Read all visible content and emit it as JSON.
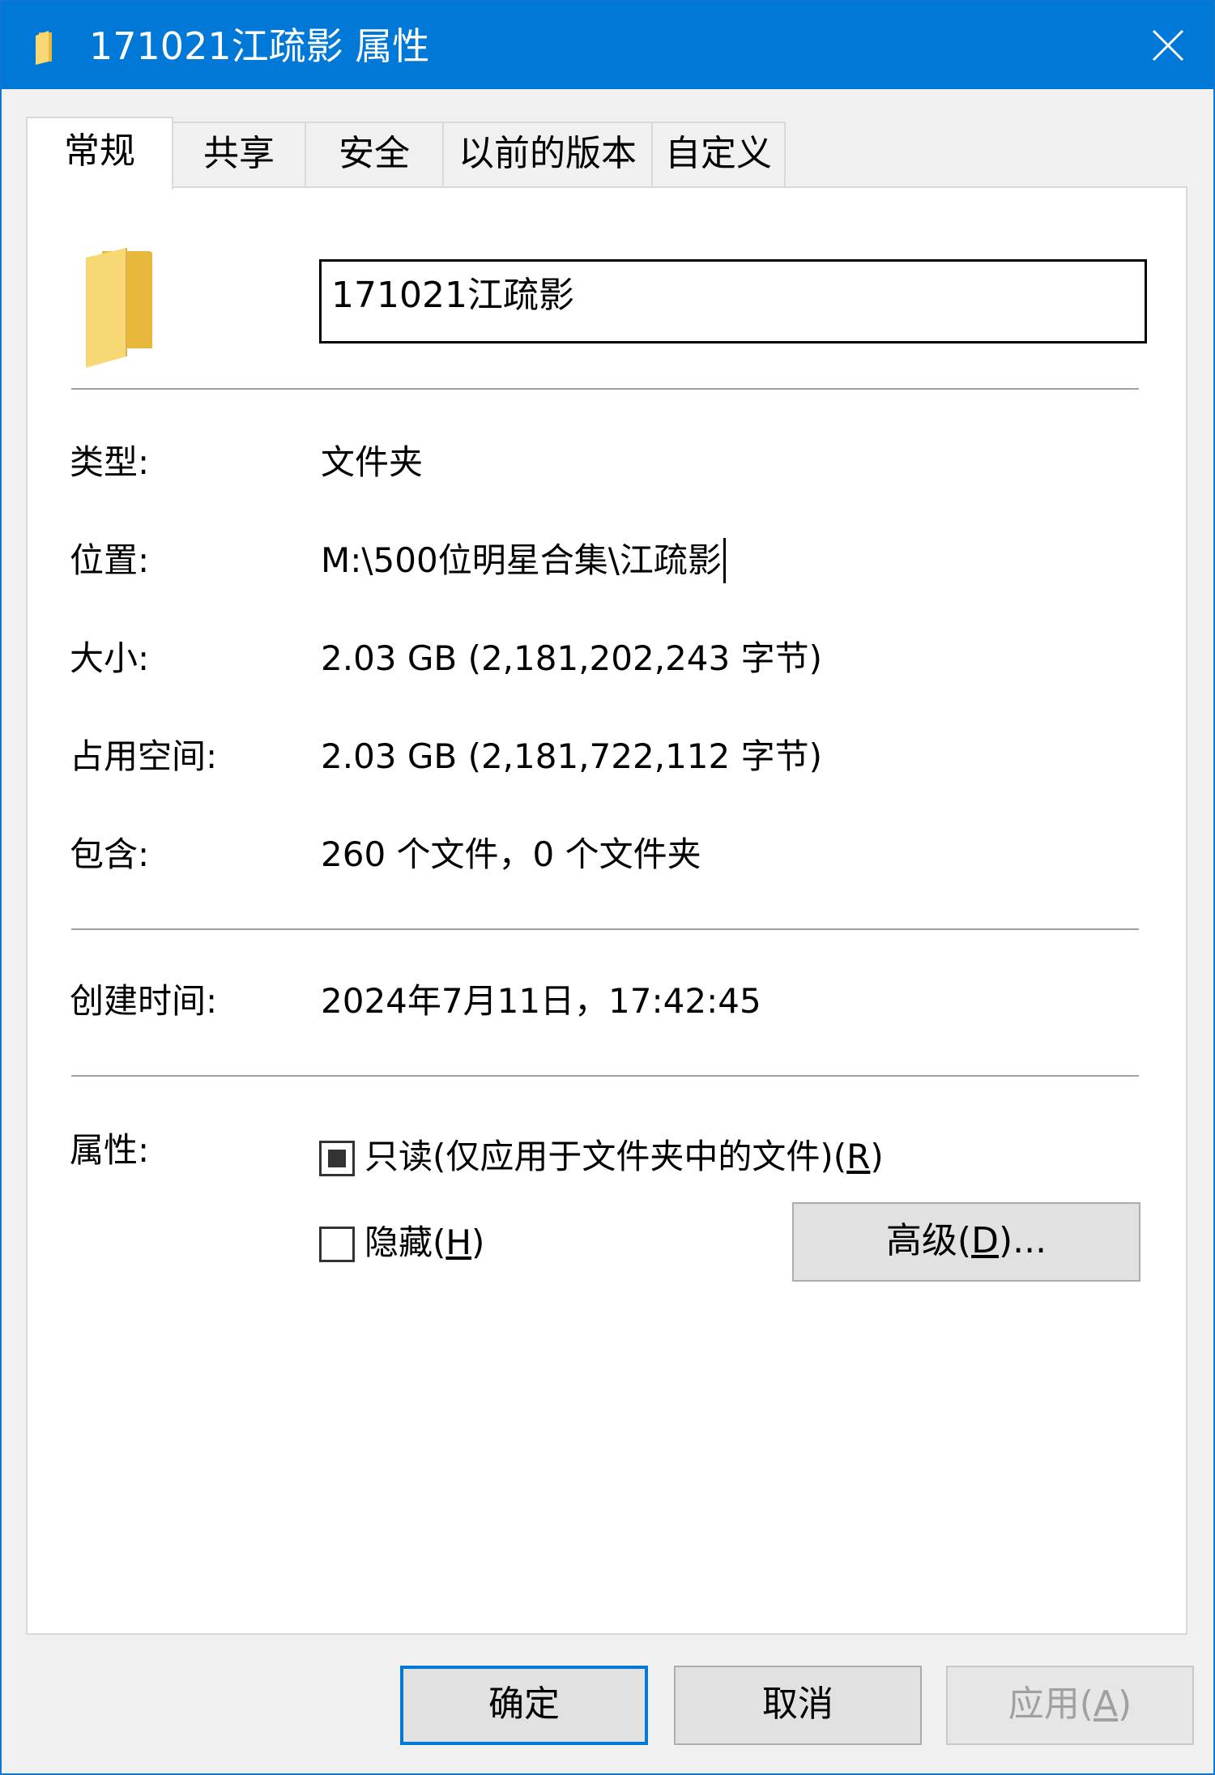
{
  "window": {
    "title": "171021江疏影 属性"
  },
  "tabs": [
    {
      "label": "常规",
      "active": true
    },
    {
      "label": "共享",
      "active": false
    },
    {
      "label": "安全",
      "active": false
    },
    {
      "label": "以前的版本",
      "active": false
    },
    {
      "label": "自定义",
      "active": false
    }
  ],
  "general": {
    "name_value": "171021江疏影",
    "type_label": "类型:",
    "type_value": "文件夹",
    "location_label": "位置:",
    "location_value": "M:\\500位明星合集\\江疏影",
    "size_label": "大小:",
    "size_value": "2.03 GB (2,181,202,243 字节)",
    "size_on_disk_label": "占用空间:",
    "size_on_disk_value": "2.03 GB (2,181,722,112 字节)",
    "contains_label": "包含:",
    "contains_value": "260 个文件，0 个文件夹",
    "created_label": "创建时间:",
    "created_value": "2024年7月11日，17:42:45",
    "attributes_label": "属性:",
    "readonly_label_prefix": "只读(仅应用于文件夹中的文件)(",
    "readonly_accel": "R",
    "readonly_label_suffix": ")",
    "readonly_state": "indeterminate",
    "hidden_label_prefix": "隐藏(",
    "hidden_accel": "H",
    "hidden_label_suffix": ")",
    "hidden_checked": false,
    "advanced_prefix": "高级(",
    "advanced_accel": "D",
    "advanced_suffix": ")..."
  },
  "footer": {
    "ok_label": "确定",
    "cancel_label": "取消",
    "apply_prefix": "应用(",
    "apply_accel": "A",
    "apply_suffix": ")"
  },
  "colors": {
    "titlebar": "#0078d7",
    "folder": "#f8d775",
    "primary_border": "#0078d7"
  },
  "icons": {
    "title": "folder-icon",
    "close": "close-icon",
    "large": "folder-icon"
  }
}
